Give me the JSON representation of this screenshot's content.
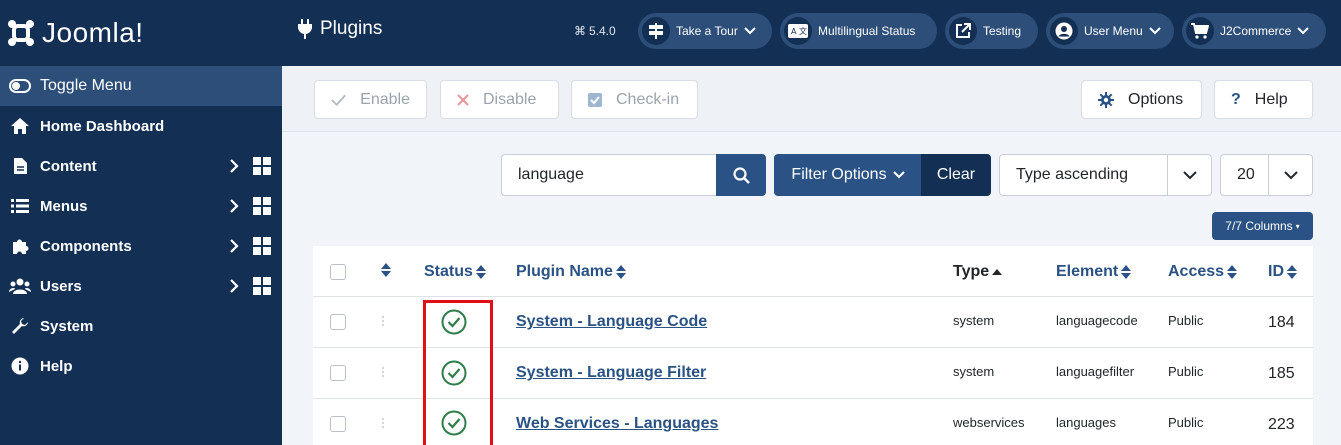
{
  "brand": {
    "name": "Joomla!"
  },
  "sidebar": {
    "items": [
      {
        "label": "Toggle Menu",
        "icon": "toggle-icon"
      },
      {
        "label": "Home Dashboard",
        "icon": "home-icon"
      },
      {
        "label": "Content",
        "icon": "file-icon"
      },
      {
        "label": "Menus",
        "icon": "list-icon"
      },
      {
        "label": "Components",
        "icon": "puzzle-icon"
      },
      {
        "label": "Users",
        "icon": "users-icon"
      },
      {
        "label": "System",
        "icon": "wrench-icon"
      },
      {
        "label": "Help",
        "icon": "info-icon"
      }
    ]
  },
  "header": {
    "title": "Plugins",
    "version": "5.4.0",
    "buttons": {
      "tour": "Take a Tour",
      "multilingual": "Multilingual Status",
      "testing": "Testing",
      "user_menu": "User Menu",
      "j2commerce": "J2Commerce"
    }
  },
  "toolbar": {
    "enable": "Enable",
    "disable": "Disable",
    "checkin": "Check-in",
    "options": "Options",
    "help": "Help"
  },
  "filters": {
    "search_value": "language",
    "filter_options": "Filter Options",
    "clear": "Clear",
    "sort": "Type ascending",
    "limit": "20",
    "columns": "7/7 Columns"
  },
  "table": {
    "headers": {
      "status": "Status",
      "plugin_name": "Plugin Name",
      "type": "Type",
      "element": "Element",
      "access": "Access",
      "id": "ID"
    },
    "rows": [
      {
        "name": "System - Language Code",
        "type": "system",
        "element": "languagecode",
        "access": "Public",
        "id": "184"
      },
      {
        "name": "System - Language Filter",
        "type": "system",
        "element": "languagefilter",
        "access": "Public",
        "id": "185"
      },
      {
        "name": "Web Services - Languages",
        "type": "webservices",
        "element": "languages",
        "access": "Public",
        "id": "223"
      }
    ]
  },
  "colors": {
    "sidebar_bg": "#132f53",
    "accent": "#2a5284",
    "status_green": "#2f7d4a",
    "highlight_red": "#e00f15"
  }
}
